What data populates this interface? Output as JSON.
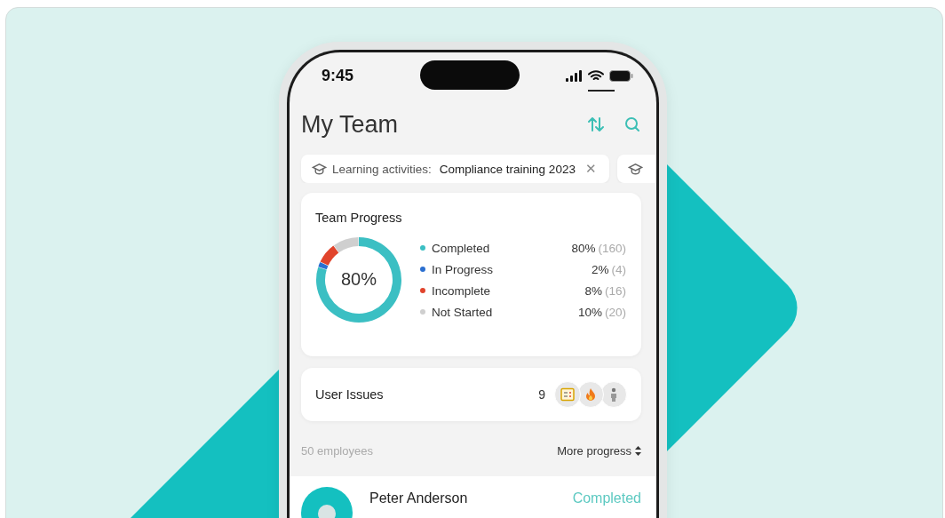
{
  "status_bar": {
    "time": "9:45"
  },
  "header": {
    "title": "My Team"
  },
  "filters": [
    {
      "kind": "full",
      "label": "Learning activities:",
      "value": "Compliance training 2023",
      "close": "✕"
    },
    {
      "kind": "partial"
    }
  ],
  "team_progress": {
    "title": "Team Progress",
    "center_label": "80%",
    "chart_data": {
      "type": "donut",
      "categories": [
        "Completed",
        "In Progress",
        "Incomplete",
        "Not Started"
      ],
      "values": [
        80,
        2,
        8,
        10
      ]
    },
    "legend": [
      {
        "color": "#3bbfc3",
        "percent": "80%",
        "count": "(160)"
      },
      {
        "color": "#2b6fd0",
        "percent": "2%",
        "count": "(4)"
      },
      {
        "color": "#e1442c",
        "percent": "8%",
        "count": "(16)"
      },
      {
        "color": "#cfcfcf",
        "percent": "10%",
        "count": "(20)"
      }
    ]
  },
  "user_issues": {
    "title": "User Issues",
    "count": "9"
  },
  "list_header": {
    "count": "50 employees",
    "sort": "More progress"
  },
  "employees": [
    {
      "name": "Peter Anderson",
      "status": "Completed"
    }
  ]
}
